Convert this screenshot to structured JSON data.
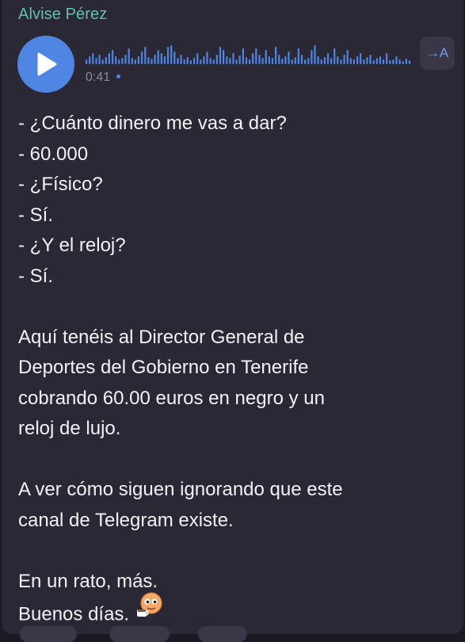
{
  "message": {
    "sender": "Alvise Pérez",
    "voice": {
      "duration": "0:41",
      "transcribe_label": "→A"
    },
    "lines": [
      "- ¿Cuánto dinero me vas a dar?",
      "- 60.000",
      "- ¿Físico?",
      "- Sí.",
      "- ¿Y el reloj?",
      "- Sí.",
      "",
      "Aquí tenéis al Director General de",
      "Deportes del Gobierno en Tenerife",
      "cobrando 60.00 euros en negro y un",
      "reloj de lujo.",
      "",
      "A ver cómo siguen ignorando que este",
      "canal de Telegram existe.",
      "",
      "En un rato, más.",
      "Buenos días."
    ],
    "emoji": "coffee-face-emoji"
  },
  "colors": {
    "background": "#1b1a22",
    "bubble": "#2a2834",
    "sender": "#5fc1b6",
    "accent": "#4f85e3",
    "text": "#f2f2f5"
  }
}
